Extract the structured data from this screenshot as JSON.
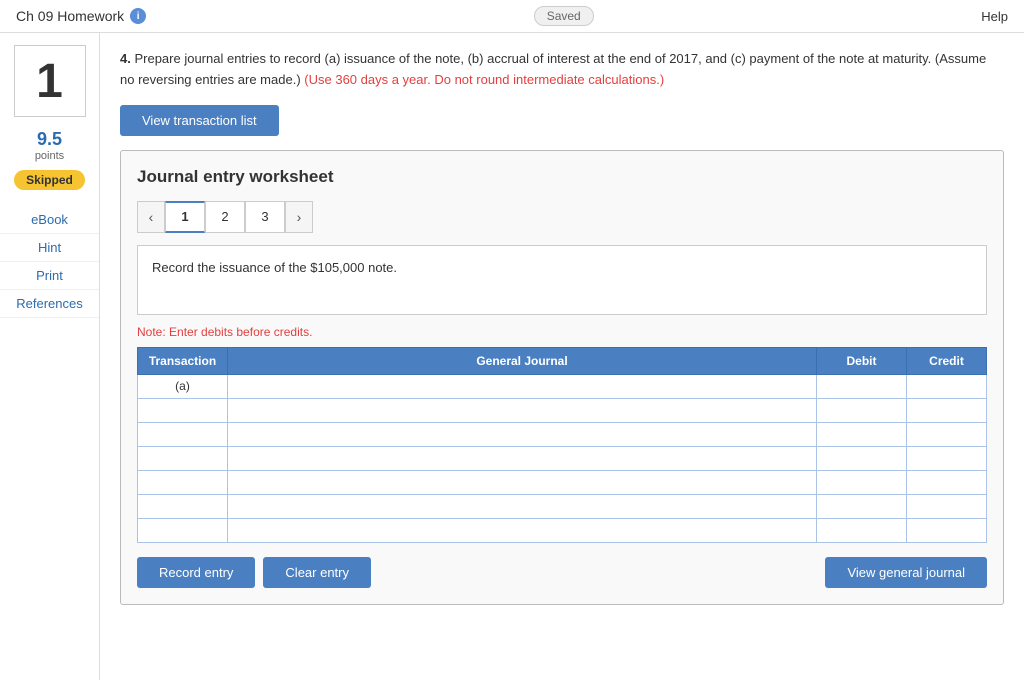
{
  "topBar": {
    "title": "Ch 09 Homework",
    "infoIcon": "i",
    "savedLabel": "Saved",
    "helpLabel": "Help"
  },
  "leftPanel": {
    "questionNumber": "1",
    "pointsValue": "9.5",
    "pointsLabel": "points",
    "skippedLabel": "Skipped",
    "navItems": [
      {
        "label": "eBook"
      },
      {
        "label": "Hint"
      },
      {
        "label": "Print"
      },
      {
        "label": "References"
      }
    ]
  },
  "content": {
    "questionNumber": "4.",
    "questionText": " Prepare journal entries to record (a) issuance of the note, (b) accrual of interest at the end of 2017, and (c) payment of the note at maturity. (Assume no reversing entries are made.)",
    "redNote": "(Use 360 days a year. Do not round intermediate calculations.)",
    "viewTransactionLabel": "View transaction list",
    "worksheetTitle": "Journal entry worksheet",
    "pages": [
      {
        "label": "1",
        "active": true
      },
      {
        "label": "2",
        "active": false
      },
      {
        "label": "3",
        "active": false
      }
    ],
    "instructionText": "Record the issuance of the $105,000 note.",
    "noteText": "Note: Enter debits before credits.",
    "tableHeaders": {
      "transaction": "Transaction",
      "generalJournal": "General Journal",
      "debit": "Debit",
      "credit": "Credit"
    },
    "tableRows": [
      {
        "transaction": "(a)",
        "generalJournal": "",
        "debit": "",
        "credit": ""
      },
      {
        "transaction": "",
        "generalJournal": "",
        "debit": "",
        "credit": ""
      },
      {
        "transaction": "",
        "generalJournal": "",
        "debit": "",
        "credit": ""
      },
      {
        "transaction": "",
        "generalJournal": "",
        "debit": "",
        "credit": ""
      },
      {
        "transaction": "",
        "generalJournal": "",
        "debit": "",
        "credit": ""
      },
      {
        "transaction": "",
        "generalJournal": "",
        "debit": "",
        "credit": ""
      },
      {
        "transaction": "",
        "generalJournal": "",
        "debit": "",
        "credit": ""
      }
    ],
    "buttons": {
      "recordEntry": "Record entry",
      "clearEntry": "Clear entry",
      "viewGeneralJournal": "View general journal"
    }
  }
}
